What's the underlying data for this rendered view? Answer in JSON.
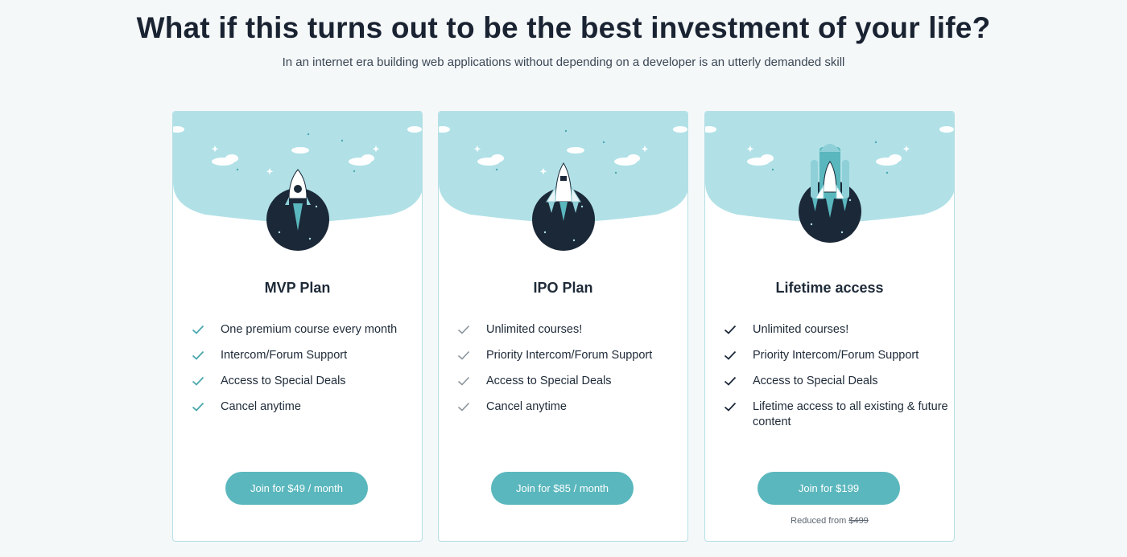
{
  "header": {
    "title": "What if this turns out to be the best investment of your life?",
    "subtitle": "In an internet era building web applications without depending on a developer is an utterly demanded skill"
  },
  "colors": {
    "sky": "#b1e1e7",
    "planet": "#1b2838",
    "button": "#5ab7bd",
    "check_teal": "#4aa7ad",
    "check_gray": "#8c959c",
    "check_dark": "#1b2838",
    "border": "#b5dfe5"
  },
  "plans": [
    {
      "name": "MVP Plan",
      "features": [
        "One premium course every month",
        "Intercom/Forum Support",
        "Access to Special Deals",
        "Cancel anytime"
      ],
      "button_label": "Join for $49 / month",
      "check_icon": "check-icon"
    },
    {
      "name": "IPO Plan",
      "features": [
        "Unlimited courses!",
        "Priority Intercom/Forum Support",
        "Access to Special Deals",
        "Cancel anytime"
      ],
      "button_label": "Join for $85 / month",
      "check_icon": "check-icon"
    },
    {
      "name": "Lifetime access",
      "features": [
        "Unlimited courses!",
        "Priority Intercom/Forum Support",
        "Access to Special Deals",
        "Lifetime access to all existing & future content"
      ],
      "button_label": "Join for $199",
      "reduced_label": "Reduced from",
      "reduced_price": "$499",
      "check_icon": "check-icon"
    }
  ]
}
